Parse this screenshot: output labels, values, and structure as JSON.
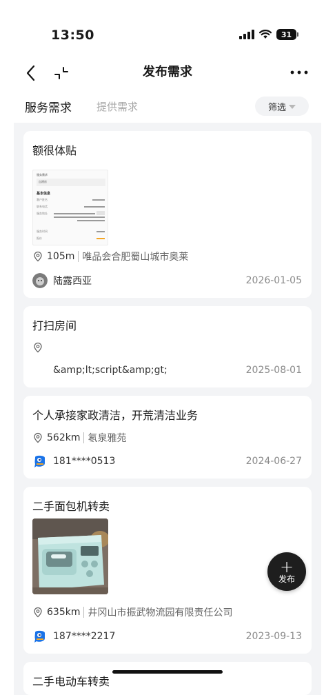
{
  "status_bar": {
    "time": "13:50",
    "battery": "31"
  },
  "nav": {
    "title": "发布需求"
  },
  "tabs": {
    "active": "服务需求",
    "inactive": "提供需求",
    "filter": "筛选"
  },
  "cards": [
    {
      "title": "额很体贴",
      "distance": "105m",
      "place": "唯品会合肥蜀山城市奥莱",
      "user": "陆露西亚",
      "date": "2026-01-05",
      "thumb_text": {
        "service_label": "服务需求",
        "section": "基本信息",
        "desc": "自建房",
        "line1": "客户姓名",
        "line2": "联系电话",
        "line3": "服务地址",
        "line4": "服务时间",
        "line5": "报价"
      }
    },
    {
      "title": "打扫房间",
      "user": "&amp;lt;script&amp;gt;",
      "date": "2025-08-01"
    },
    {
      "title": "个人承接家政清洁，开荒清洁业务",
      "distance": "562km",
      "place": "氡泉雅苑",
      "user": "181****0513",
      "date": "2024-06-27"
    },
    {
      "title": "二手面包机转卖",
      "distance": "635km",
      "place": "井冈山市振武物流园有限责任公司",
      "user": "187****2217",
      "date": "2023-09-13"
    },
    {
      "title": "二手电动车转卖"
    }
  ],
  "fab": {
    "plus": "+",
    "label": "发布"
  },
  "colors": {
    "accent": "#1e1e1e",
    "list_bg": "#f3f4f6",
    "brand_avatar": "#1a73e8"
  }
}
